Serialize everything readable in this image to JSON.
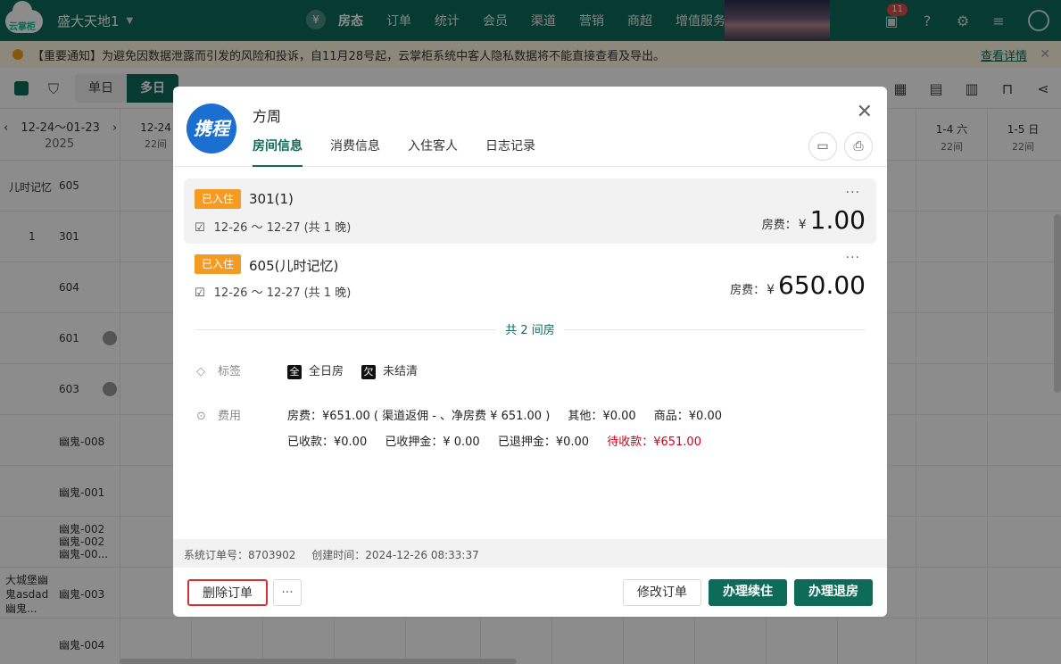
{
  "topbar": {
    "logo": "云掌柜",
    "store": "盛大天地1",
    "nav": [
      "房态",
      "订单",
      "统计",
      "会员",
      "渠道",
      "营销",
      "商超",
      "增值服务"
    ],
    "message_badge": "11"
  },
  "notice": {
    "text": "【重要通知】为避免因数据泄露而引发的风险和投诉，自11月28号起，云掌柜系统中客人隐私数据将不能直接查看及导出。",
    "link": "查看详情"
  },
  "toolbar": {
    "single": "单日",
    "multi": "多日"
  },
  "calendar": {
    "range": "12-24～01-23",
    "year": "2025",
    "columns": [
      {
        "date": "12-24",
        "sub": "22间"
      },
      {
        "date": "1-4 六",
        "sub": "22间"
      },
      {
        "date": "1-5 日",
        "sub": "22间"
      }
    ],
    "rows": [
      {
        "group": "儿时记忆",
        "room": "605"
      },
      {
        "group": "1",
        "room": "301"
      },
      {
        "group": "",
        "room": "604"
      },
      {
        "group": "",
        "room": "601"
      },
      {
        "group": "",
        "room": "603"
      },
      {
        "group": "",
        "room": "幽鬼-008"
      },
      {
        "group": "",
        "room": "幽鬼-001"
      },
      {
        "group": "",
        "room": "幽鬼-002\n幽鬼-002\n幽鬼-00..."
      },
      {
        "group": "大城堡幽\n鬼asdad\n幽鬼...",
        "room": "幽鬼-003"
      },
      {
        "group": "",
        "room": "幽鬼-004"
      }
    ]
  },
  "modal": {
    "channel_logo": "携程",
    "guest_name": "方周",
    "tabs": [
      "房间信息",
      "消费信息",
      "入住客人",
      "日志记录"
    ],
    "rooms": [
      {
        "status": "已入住",
        "name": "301(1)",
        "dates": "12-26 ～ 12-27 (共 1 晚)",
        "price_label": "房费：",
        "currency": "¥",
        "price": "1.00"
      },
      {
        "status": "已入住",
        "name": "605(儿时记忆)",
        "dates": "12-26 ～ 12-27 (共 1 晚)",
        "price_label": "房费：",
        "currency": "¥",
        "price": "650.00"
      }
    ],
    "total_rooms": "共 2 间房",
    "tag_label": "标签",
    "tags": [
      {
        "icon": "全",
        "text": "全日房"
      },
      {
        "icon": "欠",
        "text": "未结清"
      }
    ],
    "fee_label": "费用",
    "fees_line1": [
      "房费：¥651.00 ( 渠道返佣 - 、净房费 ¥ 651.00 )",
      "其他：¥0.00",
      "商品：¥0.00"
    ],
    "fees_line2": [
      "已收款：¥0.00",
      "已收押金：¥ 0.00",
      "已退押金：¥0.00"
    ],
    "pending": "待收款：¥651.00",
    "order_no": "系统订单号：8703902",
    "created": "创建时间：2024-12-26 08:33:37",
    "buttons": {
      "delete": "删除订单",
      "more": "···",
      "edit": "修改订单",
      "extend": "办理续住",
      "checkout": "办理退房"
    }
  }
}
